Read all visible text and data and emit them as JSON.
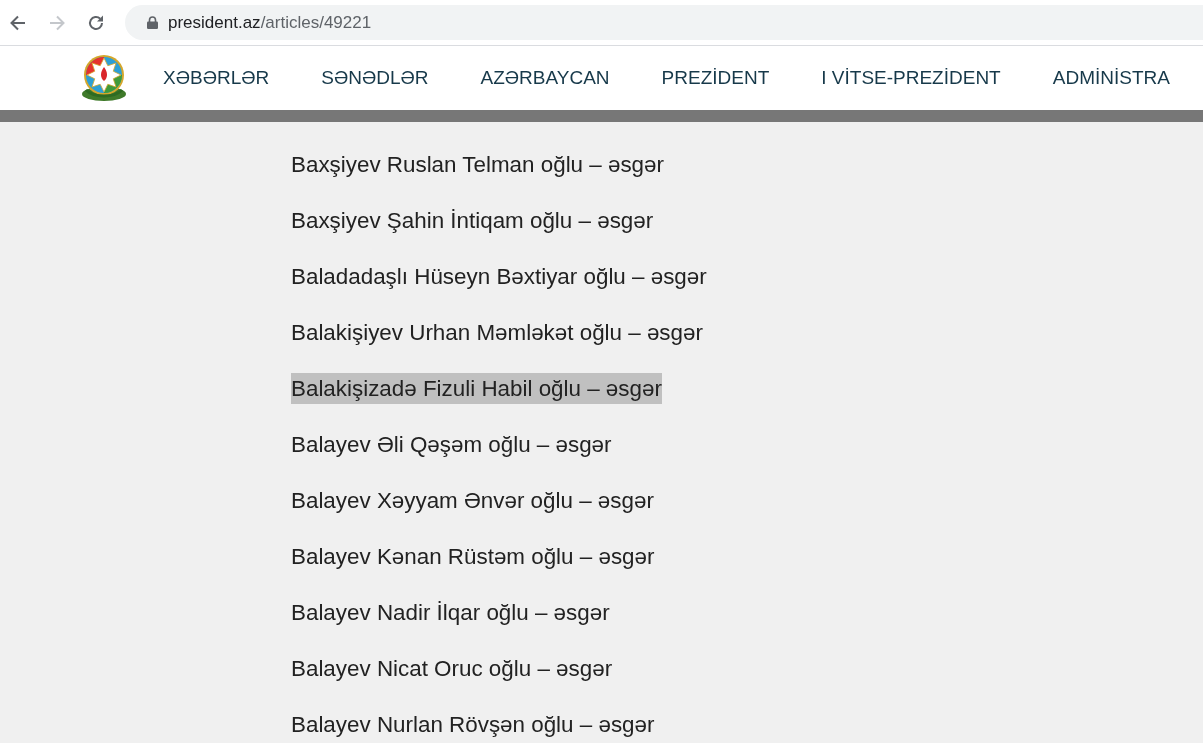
{
  "browser": {
    "nav_buttons": [
      {
        "kind": "back",
        "disabled": false
      },
      {
        "kind": "forward",
        "disabled": true
      },
      {
        "kind": "reload",
        "disabled": false
      }
    ],
    "address": {
      "secure": true,
      "host": "president.az",
      "path": "/articles/49221"
    }
  },
  "header": {
    "menu": [
      {
        "label": "XƏBƏRLƏR"
      },
      {
        "label": "SƏNƏDLƏR"
      },
      {
        "label": "AZƏRBAYCAN"
      },
      {
        "label": "PREZİDENT"
      },
      {
        "label": "I VİTSE-PREZİDENT"
      },
      {
        "label": "ADMİNİSTRA"
      }
    ]
  },
  "entries": [
    {
      "text": "Baxşiyev Ruslan Telman oğlu – əsgər",
      "selected": false
    },
    {
      "text": "Baxşiyev Şahin İntiqam oğlu – əsgər",
      "selected": false
    },
    {
      "text": "Baladadaşlı Hüseyn Bəxtiyar oğlu – əsgər",
      "selected": false
    },
    {
      "text": "Balakişiyev Urhan Məmləkət oğlu – əsgər",
      "selected": false
    },
    {
      "text": "Balakişizadə Fizuli Habil oğlu – əsgər",
      "selected": true
    },
    {
      "text": "Balayev Əli Qəşəm oğlu – əsgər",
      "selected": false
    },
    {
      "text": "Balayev Xəyyam Ənvər oğlu – əsgər",
      "selected": false
    },
    {
      "text": "Balayev Kənan Rüstəm oğlu – əsgər",
      "selected": false
    },
    {
      "text": "Balayev Nadir İlqar oğlu – əsgər",
      "selected": false
    },
    {
      "text": "Balayev Nicat Oruc oğlu – əsgər",
      "selected": false
    },
    {
      "text": "Balayev Nurlan Rövşən oğlu – əsgər",
      "selected": false
    }
  ]
}
